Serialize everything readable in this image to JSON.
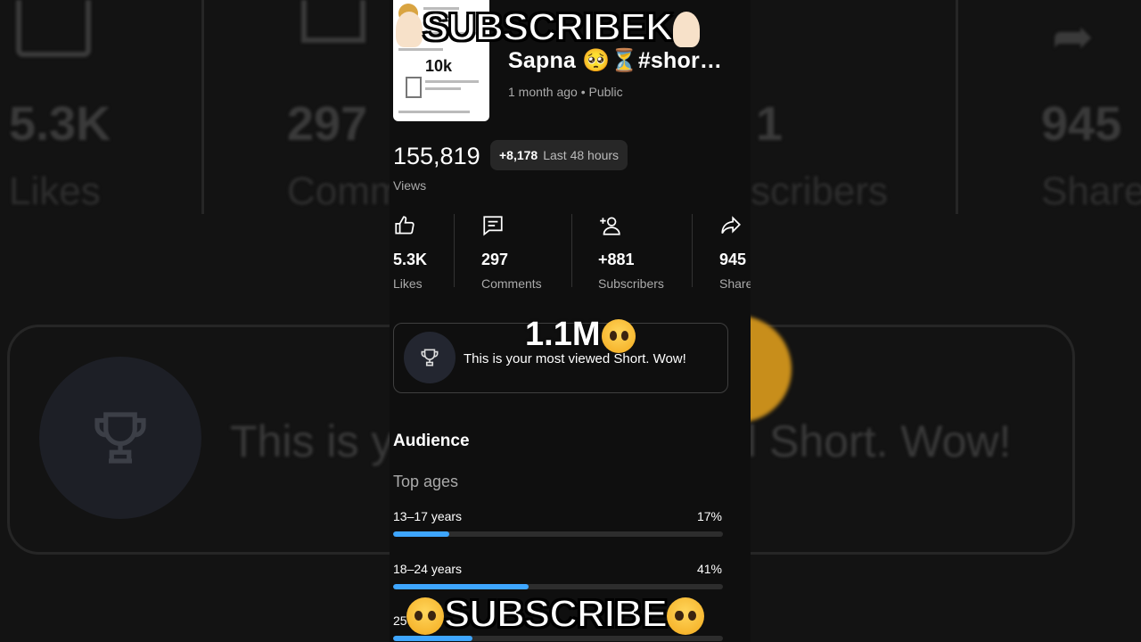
{
  "background": {
    "big_stats": [
      {
        "value": "5.3K",
        "label": "Likes"
      },
      {
        "value": "297",
        "label": "Comm"
      },
      {
        "value": "1",
        "label": "scribers"
      },
      {
        "value": "945",
        "label": "Share"
      }
    ],
    "message_left": "This is y",
    "message_right": "l Short. Wow!"
  },
  "overlay": {
    "top_subscribe": "SUBSCRIBE",
    "top_k": "K",
    "bottom_subscribe": "SUBSCRIBE",
    "milestone": "1.1M",
    "thumb_count": "10k"
  },
  "video": {
    "title": "Sapna 🥺⏳#shor…",
    "meta": "1 month ago • Public",
    "views": "155,819",
    "views_label": "Views",
    "delta": "+8,178",
    "delta_label": "Last 48 hours"
  },
  "stats": [
    {
      "value": "5.3K",
      "label": "Likes",
      "icon": "thumb-up-icon"
    },
    {
      "value": "297",
      "label": "Comments",
      "icon": "comment-icon"
    },
    {
      "value": "+881",
      "label": "Subscribers",
      "icon": "add-person-icon"
    },
    {
      "value": "945",
      "label": "Share",
      "icon": "share-icon"
    }
  ],
  "achievement": {
    "message": "This is your most viewed Short. Wow!",
    "icon": "trophy-icon"
  },
  "audience": {
    "heading": "Audience",
    "subheading": "Top ages",
    "ages": [
      {
        "label": "13–17 years",
        "pct": "17%",
        "value": 0.17
      },
      {
        "label": "18–24 years",
        "pct": "41%",
        "value": 0.41
      },
      {
        "label": "25",
        "pct": "",
        "value": 0.24
      }
    ]
  },
  "colors": {
    "accent": "#3ea6ff",
    "bg": "#0f0f0f"
  }
}
